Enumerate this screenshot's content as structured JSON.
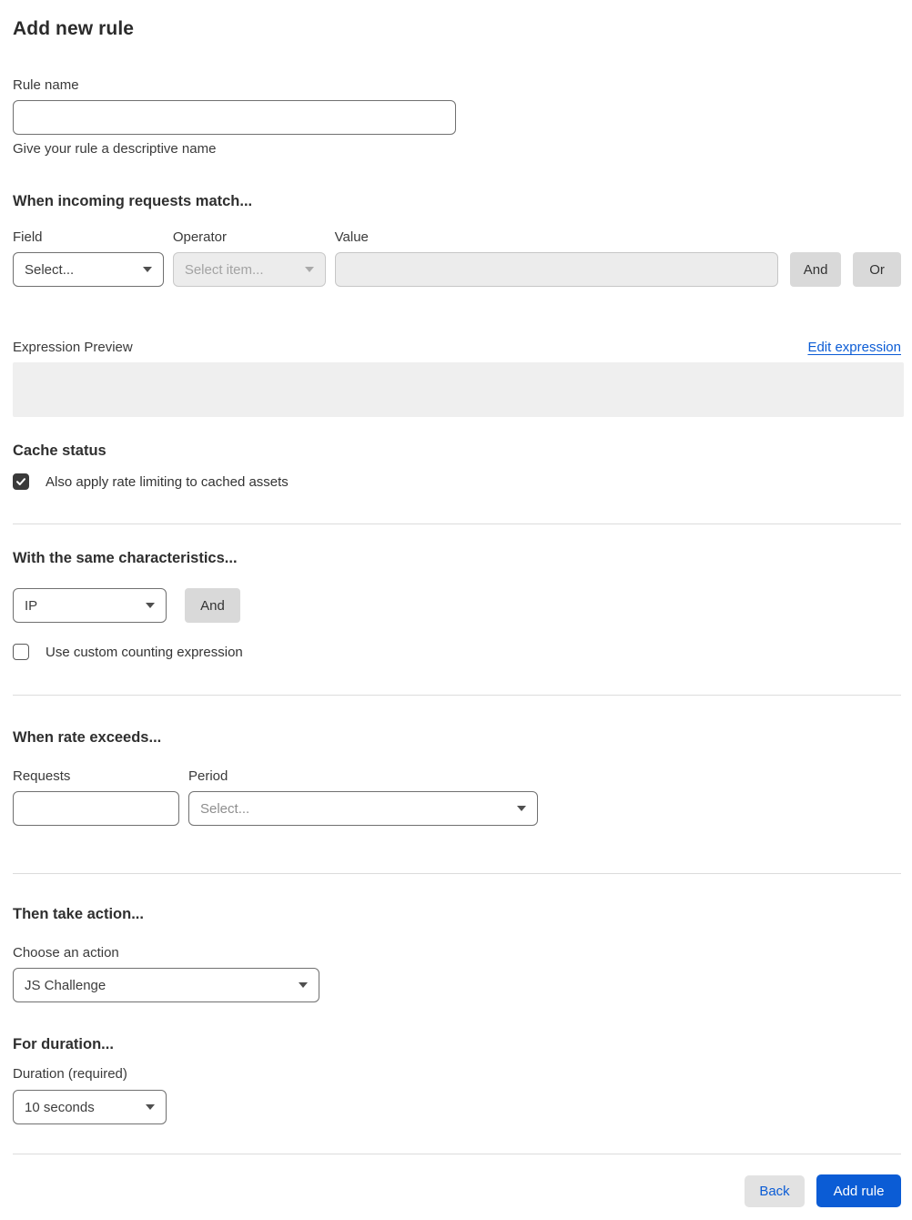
{
  "page": {
    "title": "Add new rule"
  },
  "rule_name": {
    "label": "Rule name",
    "value": "",
    "helper": "Give your rule a descriptive name"
  },
  "match": {
    "heading": "When incoming requests match...",
    "field_label": "Field",
    "field_value": "Select...",
    "operator_label": "Operator",
    "operator_value": "Select item...",
    "operator_disabled": true,
    "value_label": "Value",
    "value_text": "",
    "value_disabled": true,
    "and_label": "And",
    "or_label": "Or",
    "preview_label": "Expression Preview",
    "edit_link": "Edit expression",
    "expression_value": ""
  },
  "cache": {
    "heading": "Cache status",
    "checkbox_label": "Also apply rate limiting to cached assets",
    "checked": true
  },
  "characteristics": {
    "heading": "With the same characteristics...",
    "key_value": "IP",
    "and_label": "And",
    "checkbox_label": "Use custom counting expression",
    "checked": false
  },
  "rate": {
    "heading": "When rate exceeds...",
    "requests_label": "Requests",
    "requests_value": "",
    "period_label": "Period",
    "period_value": "Select..."
  },
  "action": {
    "heading": "Then take action...",
    "label": "Choose an action",
    "value": "JS Challenge"
  },
  "duration": {
    "heading": "For duration...",
    "label": "Duration (required)",
    "value": "10 seconds"
  },
  "footer": {
    "back_label": "Back",
    "add_label": "Add rule"
  },
  "colors": {
    "accent_blue": "#0b5cd5",
    "checkbox_checked": "#3a3a3a",
    "disabled_bg": "#ececec",
    "button_gray": "#d9d9d9"
  }
}
